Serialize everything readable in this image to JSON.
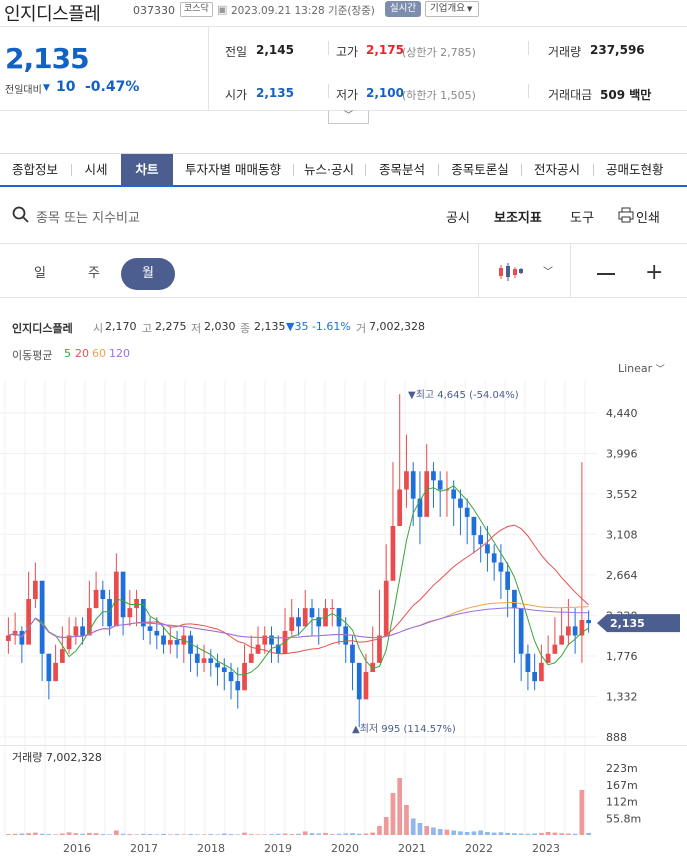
{
  "header": {
    "name": "인지디스플레",
    "code": "037330",
    "market": "코스닥",
    "datetime": "2023.09.21 13:28 기준(장중)",
    "realtime": "실시간",
    "company_info": "기업개요"
  },
  "price": {
    "current": "2,135",
    "change_label": "전일대비",
    "change": "10",
    "change_pct": "-0.47%"
  },
  "stats": {
    "prev_label": "전일",
    "prev": "2,145",
    "high_label": "고가",
    "high": "2,175",
    "upper_label": "(상한가 2,785)",
    "vol_label": "거래량",
    "vol": "237,596",
    "open_label": "시가",
    "open": "2,135",
    "low_label": "저가",
    "low": "2,100",
    "lower_label": "(하한가 1,505)",
    "amt_label": "거래대금",
    "amt": "509 백만"
  },
  "tabs": [
    "종합정보",
    "시세",
    "차트",
    "투자자별 매매동향",
    "뉴스·공시",
    "종목분석",
    "종목토론실",
    "전자공시",
    "공매도현황"
  ],
  "toolbar": {
    "search_placeholder": "종목 또는 지수비교",
    "disclosure": "공시",
    "indicator": "보조지표",
    "tools": "도구",
    "print": "인쇄"
  },
  "periods": [
    "일",
    "주",
    "월"
  ],
  "chart_info": {
    "name": "인지디스플레",
    "o_label": "시",
    "o": "2,170",
    "h_label": "고",
    "h": "2,275",
    "l_label": "저",
    "l": "2,030",
    "c_label": "종",
    "c": "2,135",
    "chg": "▼35 -1.61%",
    "v_label": "거",
    "v": "7,002,328"
  },
  "ma": {
    "label": "이동평균",
    "p5": "5",
    "p20": "20",
    "p60": "60",
    "p120": "120",
    "c5": "#3aa63a",
    "c20": "#e85050",
    "c60": "#f0a050",
    "c120": "#9b6fe0"
  },
  "scale": "Linear",
  "annotations": {
    "max": "▼최고 4,645 (-54.04%)",
    "min": "▲최저 995 (114.57%)"
  },
  "colors": {
    "up": "#e84c4c",
    "down": "#1e6fd9",
    "accent": "#4b5e8f"
  },
  "chart_data": {
    "type": "candlestick",
    "y_ticks": [
      "4,440",
      "3,996",
      "3,552",
      "3,108",
      "2,664",
      "2,220",
      "1,776",
      "1,332",
      "888"
    ],
    "y_tick_values": [
      4440,
      3996,
      3552,
      3108,
      2664,
      2220,
      1776,
      1332,
      888
    ],
    "last_price_tag": "2,135",
    "x_labels": [
      "2016",
      "2017",
      "2018",
      "2019",
      "2020",
      "2021",
      "2022",
      "2023"
    ],
    "volume_label": "거래량 7,002,328",
    "volume_ticks": [
      "223m",
      "167m",
      "112m",
      "55.8m"
    ],
    "volume_tick_values": [
      223,
      167,
      112,
      55.8
    ],
    "monthly_close": [
      2000,
      2050,
      1900,
      2400,
      2600,
      1800,
      1500,
      1700,
      1850,
      2000,
      2100,
      2000,
      2300,
      2500,
      2400,
      2100,
      2700,
      2200,
      2300,
      2400,
      2100,
      2050,
      2000,
      1900,
      1950,
      1900,
      2000,
      1800,
      1700,
      1750,
      1700,
      1650,
      1600,
      1500,
      1400,
      1700,
      1800,
      1900,
      2000,
      1900,
      1800,
      2050,
      2200,
      2100,
      2300,
      2200,
      2100,
      2300,
      2300,
      2100,
      1900,
      1700,
      1300,
      1600,
      1700,
      2000,
      2600,
      3200,
      3600,
      3800,
      3500,
      3300,
      3800,
      3700,
      3600,
      3600,
      3500,
      3400,
      3300,
      3100,
      3000,
      2900,
      2800,
      2700,
      2500,
      2300,
      1800,
      1600,
      1500,
      1700,
      1800,
      1900,
      2000,
      2100,
      2000,
      2170,
      2135
    ],
    "monthly_high": [
      2200,
      2250,
      2100,
      2700,
      2800,
      2300,
      1800,
      1900,
      2100,
      2200,
      2200,
      2200,
      2600,
      2700,
      2600,
      2500,
      2900,
      2600,
      2500,
      2500,
      2300,
      2200,
      2200,
      2100,
      2100,
      2050,
      2100,
      2050,
      1900,
      1900,
      1850,
      1800,
      1750,
      1700,
      1650,
      1900,
      2000,
      2100,
      2100,
      2100,
      2000,
      2300,
      2400,
      2300,
      2500,
      2400,
      2300,
      2400,
      2400,
      2300,
      2200,
      2000,
      1700,
      1800,
      2100,
      2500,
      3000,
      3900,
      4645,
      4200,
      3900,
      3800,
      4100,
      3900,
      3800,
      3800,
      3700,
      3600,
      3500,
      3300,
      3200,
      3200,
      3000,
      3000,
      2800,
      2500,
      2300,
      1900,
      1800,
      1900,
      2000,
      2200,
      2300,
      2400,
      2300,
      3900,
      2275
    ],
    "monthly_low": [
      1800,
      1900,
      1700,
      1900,
      2300,
      1500,
      1300,
      1600,
      1700,
      1800,
      1900,
      1900,
      2000,
      2300,
      2100,
      2000,
      2200,
      2000,
      2100,
      2100,
      1950,
      1900,
      1850,
      1800,
      1800,
      1750,
      1700,
      1600,
      1550,
      1600,
      1550,
      1450,
      1400,
      1300,
      1200,
      1600,
      1700,
      1800,
      1800,
      1700,
      1700,
      1900,
      2000,
      2000,
      2100,
      2000,
      1900,
      2100,
      2100,
      1900,
      1700,
      1400,
      995,
      1400,
      1600,
      1800,
      2400,
      3000,
      3200,
      3400,
      3200,
      3000,
      3500,
      3400,
      3300,
      3300,
      3200,
      3100,
      3000,
      2900,
      2800,
      2700,
      2600,
      2400,
      2200,
      1700,
      1500,
      1400,
      1400,
      1500,
      1700,
      1800,
      1900,
      1900,
      1800,
      1700,
      2030
    ],
    "monthly_volume": [
      3,
      4,
      5,
      6,
      8,
      4,
      3,
      2,
      5,
      9,
      6,
      4,
      7,
      6,
      3,
      2,
      15,
      4,
      3,
      2,
      4,
      3,
      2,
      4,
      2,
      3,
      2,
      3,
      2,
      2,
      3,
      2,
      5,
      3,
      2,
      8,
      3,
      2,
      2,
      3,
      4,
      5,
      3,
      4,
      12,
      6,
      5,
      7,
      3,
      4,
      5,
      6,
      4,
      5,
      8,
      30,
      60,
      140,
      190,
      100,
      55,
      40,
      30,
      25,
      20,
      18,
      15,
      12,
      10,
      12,
      15,
      10,
      8,
      9,
      7,
      6,
      5,
      4,
      5,
      7,
      10,
      8,
      6,
      5,
      4,
      150,
      7
    ]
  }
}
